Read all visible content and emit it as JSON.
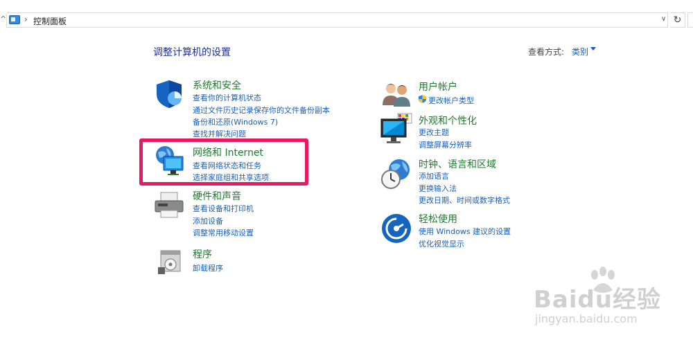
{
  "address_bar": {
    "crumb": "控制面板"
  },
  "header": {
    "title": "调整计算机的设置",
    "view_label": "查看方式:",
    "view_value": "类别"
  },
  "categories": {
    "system_security": {
      "title": "系统和安全",
      "links": [
        "查看你的计算机状态",
        "通过文件历史记录保存你的文件备份副本",
        "备份和还原(Windows 7)",
        "查找并解决问题"
      ]
    },
    "network_internet": {
      "title": "网络和 Internet",
      "links": [
        "查看网络状态和任务",
        "选择家庭组和共享选项"
      ]
    },
    "hardware_sound": {
      "title": "硬件和声音",
      "links": [
        "查看设备和打印机",
        "添加设备",
        "调整常用移动设置"
      ]
    },
    "programs": {
      "title": "程序",
      "links": [
        "卸载程序"
      ]
    },
    "user_accounts": {
      "title": "用户帐户",
      "links": [
        "更改帐户类型"
      ]
    },
    "appearance": {
      "title": "外观和个性化",
      "links": [
        "更改主题",
        "调整屏幕分辨率"
      ]
    },
    "clock_region": {
      "title": "时钟、语言和区域",
      "links": [
        "添加语言",
        "更换输入法",
        "更改日期、时间或数字格式"
      ]
    },
    "ease_of_access": {
      "title": "轻松使用",
      "links": [
        "使用 Windows 建议的设置",
        "优化视觉显示"
      ]
    }
  },
  "watermark": {
    "logo": "Baidu经验",
    "url": "jingyan.baidu.com"
  },
  "colors": {
    "title_blue": "#1e3287",
    "link_blue": "#1a5fb4",
    "category_green": "#1e7a2d",
    "highlight_pink": "#e8195e"
  }
}
